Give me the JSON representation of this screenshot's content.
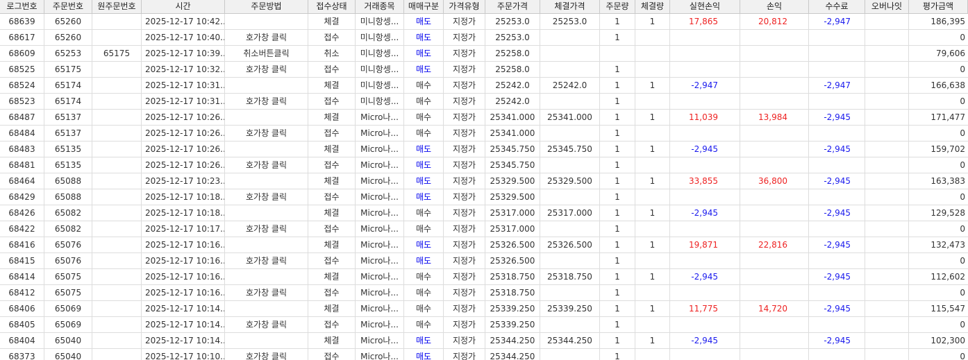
{
  "colors": {
    "sell": "#0000ee",
    "positive": "#ee2222",
    "negative": "#1a1aee",
    "header_bg": "#f1f1f1"
  },
  "columns": [
    "로그번호",
    "주문번호",
    "원주문번호",
    "시간",
    "주문방법",
    "접수상태",
    "거래종목",
    "매매구분",
    "가격유형",
    "주문가격",
    "체결가격",
    "주문량",
    "체결량",
    "실현손익",
    "손익",
    "수수료",
    "오버나잇",
    "평가금액"
  ],
  "rows": [
    {
      "log": "68639",
      "order": "65260",
      "orig": "",
      "time": "2025-12-17 10:42...",
      "method": "",
      "status": "체결",
      "symbol": "미니항셍...",
      "side": "매도",
      "ptype": "지정가",
      "oprice": "25253.0",
      "fprice": "25253.0",
      "oqty": "1",
      "fqty": "1",
      "realized": "17,865",
      "pnl": "20,812",
      "fee": "-2,947",
      "overnight": "",
      "eval": "186,395"
    },
    {
      "log": "68617",
      "order": "65260",
      "orig": "",
      "time": "2025-12-17 10:40...",
      "method": "호가창 클릭",
      "status": "접수",
      "symbol": "미니항셍...",
      "side": "매도",
      "ptype": "지정가",
      "oprice": "25253.0",
      "fprice": "",
      "oqty": "1",
      "fqty": "",
      "realized": "",
      "pnl": "",
      "fee": "",
      "overnight": "",
      "eval": "0"
    },
    {
      "log": "68609",
      "order": "65253",
      "orig": "65175",
      "time": "2025-12-17 10:39...",
      "method": "취소버튼클릭",
      "status": "취소",
      "symbol": "미니항셍...",
      "side": "매도",
      "ptype": "지정가",
      "oprice": "25258.0",
      "fprice": "",
      "oqty": "",
      "fqty": "",
      "realized": "",
      "pnl": "",
      "fee": "",
      "overnight": "",
      "eval": "79,606"
    },
    {
      "log": "68525",
      "order": "65175",
      "orig": "",
      "time": "2025-12-17 10:32...",
      "method": "호가창 클릭",
      "status": "접수",
      "symbol": "미니항셍...",
      "side": "매도",
      "ptype": "지정가",
      "oprice": "25258.0",
      "fprice": "",
      "oqty": "1",
      "fqty": "",
      "realized": "",
      "pnl": "",
      "fee": "",
      "overnight": "",
      "eval": "0"
    },
    {
      "log": "68524",
      "order": "65174",
      "orig": "",
      "time": "2025-12-17 10:31...",
      "method": "",
      "status": "체결",
      "symbol": "미니항셍...",
      "side": "매수",
      "ptype": "지정가",
      "oprice": "25242.0",
      "fprice": "25242.0",
      "oqty": "1",
      "fqty": "1",
      "realized": "-2,947",
      "pnl": "",
      "fee": "-2,947",
      "overnight": "",
      "eval": "166,638"
    },
    {
      "log": "68523",
      "order": "65174",
      "orig": "",
      "time": "2025-12-17 10:31...",
      "method": "호가창 클릭",
      "status": "접수",
      "symbol": "미니항셍...",
      "side": "매수",
      "ptype": "지정가",
      "oprice": "25242.0",
      "fprice": "",
      "oqty": "1",
      "fqty": "",
      "realized": "",
      "pnl": "",
      "fee": "",
      "overnight": "",
      "eval": "0"
    },
    {
      "log": "68487",
      "order": "65137",
      "orig": "",
      "time": "2025-12-17 10:26...",
      "method": "",
      "status": "체결",
      "symbol": "Micro나...",
      "side": "매수",
      "ptype": "지정가",
      "oprice": "25341.000",
      "fprice": "25341.000",
      "oqty": "1",
      "fqty": "1",
      "realized": "11,039",
      "pnl": "13,984",
      "fee": "-2,945",
      "overnight": "",
      "eval": "171,477"
    },
    {
      "log": "68484",
      "order": "65137",
      "orig": "",
      "time": "2025-12-17 10:26...",
      "method": "호가창 클릭",
      "status": "접수",
      "symbol": "Micro나...",
      "side": "매수",
      "ptype": "지정가",
      "oprice": "25341.000",
      "fprice": "",
      "oqty": "1",
      "fqty": "",
      "realized": "",
      "pnl": "",
      "fee": "",
      "overnight": "",
      "eval": "0"
    },
    {
      "log": "68483",
      "order": "65135",
      "orig": "",
      "time": "2025-12-17 10:26...",
      "method": "",
      "status": "체결",
      "symbol": "Micro나...",
      "side": "매도",
      "ptype": "지정가",
      "oprice": "25345.750",
      "fprice": "25345.750",
      "oqty": "1",
      "fqty": "1",
      "realized": "-2,945",
      "pnl": "",
      "fee": "-2,945",
      "overnight": "",
      "eval": "159,702"
    },
    {
      "log": "68481",
      "order": "65135",
      "orig": "",
      "time": "2025-12-17 10:26...",
      "method": "호가창 클릭",
      "status": "접수",
      "symbol": "Micro나...",
      "side": "매도",
      "ptype": "지정가",
      "oprice": "25345.750",
      "fprice": "",
      "oqty": "1",
      "fqty": "",
      "realized": "",
      "pnl": "",
      "fee": "",
      "overnight": "",
      "eval": "0"
    },
    {
      "log": "68464",
      "order": "65088",
      "orig": "",
      "time": "2025-12-17 10:23...",
      "method": "",
      "status": "체결",
      "symbol": "Micro나...",
      "side": "매도",
      "ptype": "지정가",
      "oprice": "25329.500",
      "fprice": "25329.500",
      "oqty": "1",
      "fqty": "1",
      "realized": "33,855",
      "pnl": "36,800",
      "fee": "-2,945",
      "overnight": "",
      "eval": "163,383"
    },
    {
      "log": "68429",
      "order": "65088",
      "orig": "",
      "time": "2025-12-17 10:18...",
      "method": "호가창 클릭",
      "status": "접수",
      "symbol": "Micro나...",
      "side": "매도",
      "ptype": "지정가",
      "oprice": "25329.500",
      "fprice": "",
      "oqty": "1",
      "fqty": "",
      "realized": "",
      "pnl": "",
      "fee": "",
      "overnight": "",
      "eval": "0"
    },
    {
      "log": "68426",
      "order": "65082",
      "orig": "",
      "time": "2025-12-17 10:18...",
      "method": "",
      "status": "체결",
      "symbol": "Micro나...",
      "side": "매수",
      "ptype": "지정가",
      "oprice": "25317.000",
      "fprice": "25317.000",
      "oqty": "1",
      "fqty": "1",
      "realized": "-2,945",
      "pnl": "",
      "fee": "-2,945",
      "overnight": "",
      "eval": "129,528"
    },
    {
      "log": "68422",
      "order": "65082",
      "orig": "",
      "time": "2025-12-17 10:17...",
      "method": "호가창 클릭",
      "status": "접수",
      "symbol": "Micro나...",
      "side": "매수",
      "ptype": "지정가",
      "oprice": "25317.000",
      "fprice": "",
      "oqty": "1",
      "fqty": "",
      "realized": "",
      "pnl": "",
      "fee": "",
      "overnight": "",
      "eval": "0"
    },
    {
      "log": "68416",
      "order": "65076",
      "orig": "",
      "time": "2025-12-17 10:16...",
      "method": "",
      "status": "체결",
      "symbol": "Micro나...",
      "side": "매도",
      "ptype": "지정가",
      "oprice": "25326.500",
      "fprice": "25326.500",
      "oqty": "1",
      "fqty": "1",
      "realized": "19,871",
      "pnl": "22,816",
      "fee": "-2,945",
      "overnight": "",
      "eval": "132,473"
    },
    {
      "log": "68415",
      "order": "65076",
      "orig": "",
      "time": "2025-12-17 10:16...",
      "method": "호가창 클릭",
      "status": "접수",
      "symbol": "Micro나...",
      "side": "매도",
      "ptype": "지정가",
      "oprice": "25326.500",
      "fprice": "",
      "oqty": "1",
      "fqty": "",
      "realized": "",
      "pnl": "",
      "fee": "",
      "overnight": "",
      "eval": "0"
    },
    {
      "log": "68414",
      "order": "65075",
      "orig": "",
      "time": "2025-12-17 10:16...",
      "method": "",
      "status": "체결",
      "symbol": "Micro나...",
      "side": "매수",
      "ptype": "지정가",
      "oprice": "25318.750",
      "fprice": "25318.750",
      "oqty": "1",
      "fqty": "1",
      "realized": "-2,945",
      "pnl": "",
      "fee": "-2,945",
      "overnight": "",
      "eval": "112,602"
    },
    {
      "log": "68412",
      "order": "65075",
      "orig": "",
      "time": "2025-12-17 10:16...",
      "method": "호가창 클릭",
      "status": "접수",
      "symbol": "Micro나...",
      "side": "매수",
      "ptype": "지정가",
      "oprice": "25318.750",
      "fprice": "",
      "oqty": "1",
      "fqty": "",
      "realized": "",
      "pnl": "",
      "fee": "",
      "overnight": "",
      "eval": "0"
    },
    {
      "log": "68406",
      "order": "65069",
      "orig": "",
      "time": "2025-12-17 10:14...",
      "method": "",
      "status": "체결",
      "symbol": "Micro나...",
      "side": "매수",
      "ptype": "지정가",
      "oprice": "25339.250",
      "fprice": "25339.250",
      "oqty": "1",
      "fqty": "1",
      "realized": "11,775",
      "pnl": "14,720",
      "fee": "-2,945",
      "overnight": "",
      "eval": "115,547"
    },
    {
      "log": "68405",
      "order": "65069",
      "orig": "",
      "time": "2025-12-17 10:14...",
      "method": "호가창 클릭",
      "status": "접수",
      "symbol": "Micro나...",
      "side": "매수",
      "ptype": "지정가",
      "oprice": "25339.250",
      "fprice": "",
      "oqty": "1",
      "fqty": "",
      "realized": "",
      "pnl": "",
      "fee": "",
      "overnight": "",
      "eval": "0"
    },
    {
      "log": "68404",
      "order": "65040",
      "orig": "",
      "time": "2025-12-17 10:14...",
      "method": "",
      "status": "체결",
      "symbol": "Micro나...",
      "side": "매도",
      "ptype": "지정가",
      "oprice": "25344.250",
      "fprice": "25344.250",
      "oqty": "1",
      "fqty": "1",
      "realized": "-2,945",
      "pnl": "",
      "fee": "-2,945",
      "overnight": "",
      "eval": "102,300"
    },
    {
      "log": "68373",
      "order": "65040",
      "orig": "",
      "time": "2025-12-17 10:10...",
      "method": "호가창 클릭",
      "status": "접수",
      "symbol": "Micro나...",
      "side": "매도",
      "ptype": "지정가",
      "oprice": "25344.250",
      "fprice": "",
      "oqty": "1",
      "fqty": "",
      "realized": "",
      "pnl": "",
      "fee": "",
      "overnight": "",
      "eval": "0"
    }
  ]
}
